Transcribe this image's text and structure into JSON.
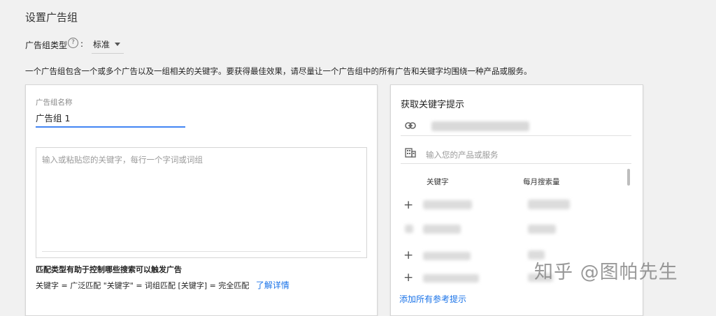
{
  "header": {
    "title": "设置广告组"
  },
  "ad_group_type": {
    "label": "广告组类型",
    "colon": ":",
    "value": "标准"
  },
  "description": "一个广告组包含一个或多个广告以及一组相关的关键字。要获得最佳效果，请尽量让一个广告组中的所有广告和关键字均围绕一种产品或服务。",
  "left_panel": {
    "name_label": "广告组名称",
    "name_value": "广告组 1",
    "keywords_placeholder": "输入或粘贴您的关键字，每行一个字词或词组",
    "match_types_title": "匹配类型有助于控制哪些搜索可以触发广告",
    "match_types_text": "关键字 = 广泛匹配 \"关键字\" = 词组匹配 [关键字] = 完全匹配",
    "learn_more": "了解详情"
  },
  "right_panel": {
    "title": "获取关键字提示",
    "product_placeholder": "输入您的产品或服务",
    "col_keyword": "关键字",
    "col_volume": "每月搜索量",
    "add_all": "添加所有参考提示"
  },
  "watermark": "知乎 @图帕先生",
  "icons": {
    "help": "question-circle-icon",
    "dropdown": "caret-down-icon",
    "link": "link-icon",
    "business": "building-icon",
    "add": "plus-icon"
  },
  "colors": {
    "accent": "#4285f4",
    "link": "#1a73e8"
  }
}
